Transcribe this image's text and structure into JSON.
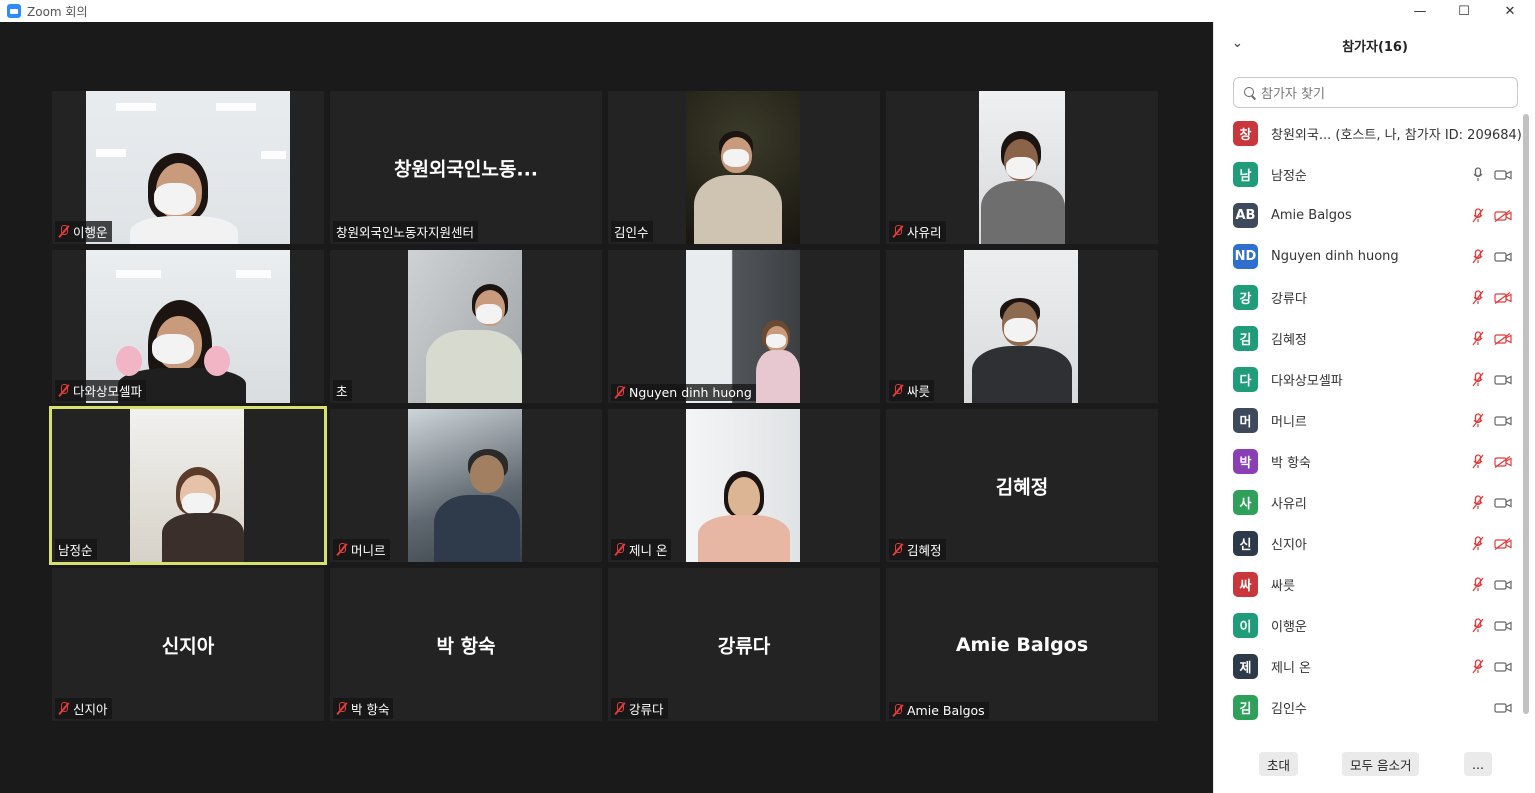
{
  "window": {
    "title": "Zoom 회의"
  },
  "tiles": [
    {
      "name": "이행운",
      "muted": true,
      "center": ""
    },
    {
      "name": "창원외국인노동자지원센터",
      "muted": false,
      "center": "창원외국인노동..."
    },
    {
      "name": "김인수",
      "muted": false,
      "center": ""
    },
    {
      "name": "사유리",
      "muted": true,
      "center": ""
    },
    {
      "name": "다와상모셀파",
      "muted": true,
      "center": ""
    },
    {
      "name": "초",
      "muted": false,
      "center": ""
    },
    {
      "name": "Nguyen dinh huong",
      "muted": true,
      "center": ""
    },
    {
      "name": "싸릇",
      "muted": true,
      "center": ""
    },
    {
      "name": "남정순",
      "muted": false,
      "center": ""
    },
    {
      "name": "머니르",
      "muted": true,
      "center": ""
    },
    {
      "name": "제니 온",
      "muted": true,
      "center": ""
    },
    {
      "name": "김혜정",
      "muted": true,
      "center": "김혜정"
    },
    {
      "name": "신지아",
      "muted": true,
      "center": "신지아"
    },
    {
      "name": "박 항숙",
      "muted": true,
      "center": "박 항숙"
    },
    {
      "name": "강류다",
      "muted": true,
      "center": "강류다"
    },
    {
      "name": "Amie Balgos",
      "muted": true,
      "center": "Amie Balgos"
    }
  ],
  "panel": {
    "title": "참가자(16)",
    "search_placeholder": "참가자 찾기",
    "participants": [
      {
        "initial": "창",
        "color": "#c9363b",
        "name": "창원외국... (호스트, 나, 참가자 ID: 209684)",
        "mic": "none",
        "cam": "none"
      },
      {
        "initial": "남",
        "color": "#1f9d7a",
        "name": "남정순",
        "mic": "on",
        "cam": "on"
      },
      {
        "initial": "AB",
        "color": "#3d4a5c",
        "name": "Amie Balgos",
        "mic": "muted",
        "cam": "off"
      },
      {
        "initial": "ND",
        "color": "#2f6fd0",
        "name": "Nguyen dinh huong",
        "mic": "muted",
        "cam": "on"
      },
      {
        "initial": "강",
        "color": "#1f9d7a",
        "name": "강류다",
        "mic": "muted",
        "cam": "off"
      },
      {
        "initial": "김",
        "color": "#1f9d7a",
        "name": "김혜정",
        "mic": "muted",
        "cam": "off"
      },
      {
        "initial": "다",
        "color": "#1f9d7a",
        "name": "다와상모셀파",
        "mic": "muted",
        "cam": "on"
      },
      {
        "initial": "머",
        "color": "#3d4a5c",
        "name": "머니르",
        "mic": "muted",
        "cam": "on"
      },
      {
        "initial": "박",
        "color": "#8b3fb5",
        "name": "박 항숙",
        "mic": "muted",
        "cam": "off"
      },
      {
        "initial": "사",
        "color": "#2fa05a",
        "name": "사유리",
        "mic": "muted",
        "cam": "on"
      },
      {
        "initial": "신",
        "color": "#2d3a4a",
        "name": "신지아",
        "mic": "muted",
        "cam": "off"
      },
      {
        "initial": "싸",
        "color": "#c9363b",
        "name": "싸릇",
        "mic": "muted",
        "cam": "on"
      },
      {
        "initial": "이",
        "color": "#1f9d7a",
        "name": "이행운",
        "mic": "muted",
        "cam": "on"
      },
      {
        "initial": "제",
        "color": "#2d3a4a",
        "name": "제니 온",
        "mic": "muted",
        "cam": "on"
      },
      {
        "initial": "김",
        "color": "#2fa05a",
        "name": "김인수",
        "mic": "none",
        "cam": "on"
      }
    ],
    "footer": {
      "invite": "초대",
      "mute_all": "모두 음소거",
      "more": "..."
    }
  },
  "colors": {
    "muted_red": "#e23b3b",
    "active_speaker": "#d8e26b",
    "meeting_bg": "#1a1a1a"
  }
}
